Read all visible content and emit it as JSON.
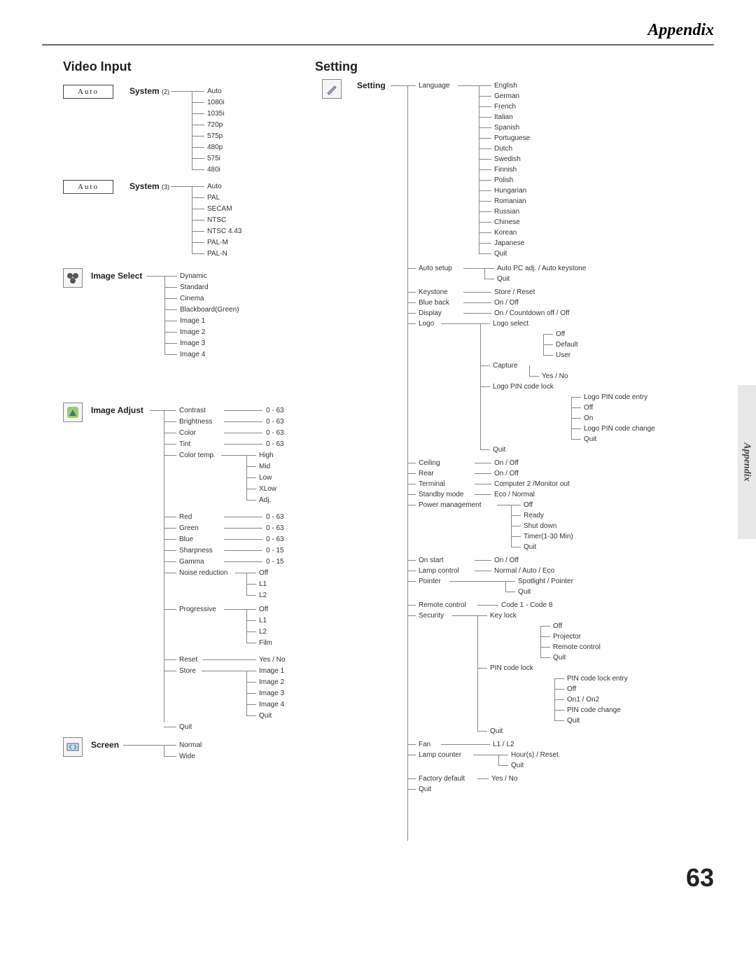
{
  "header": "Appendix",
  "sideTab": "Appendix",
  "pageNumber": "63",
  "left": {
    "title": "Video Input",
    "autoLabel": "Auto",
    "system2": {
      "label": "System",
      "sup": "(2)",
      "items": [
        "Auto",
        "1080i",
        "1035i",
        "720p",
        "575p",
        "480p",
        "575i",
        "480i"
      ]
    },
    "system3": {
      "label": "System",
      "sup": "(3)",
      "items": [
        "Auto",
        "PAL",
        "SECAM",
        "NTSC",
        "NTSC 4.43",
        "PAL-M",
        "PAL-N"
      ]
    },
    "imageSelect": {
      "label": "Image Select",
      "items": [
        "Dynamic",
        "Standard",
        "Cinema",
        "Blackboard(Green)",
        "Image 1",
        "Image 2",
        "Image 3",
        "Image 4"
      ]
    },
    "imageAdjust": {
      "label": "Image Adjust",
      "rows": [
        {
          "name": "Contrast",
          "val": "0 - 63"
        },
        {
          "name": "Brightness",
          "val": "0 - 63"
        },
        {
          "name": "Color",
          "val": "0 - 63"
        },
        {
          "name": "Tint",
          "val": "0 - 63"
        }
      ],
      "colorTemp": {
        "name": "Color temp.",
        "items": [
          "High",
          "Mid",
          "Low",
          "XLow",
          "Adj."
        ]
      },
      "rows2": [
        {
          "name": "Red",
          "val": "0 - 63"
        },
        {
          "name": "Green",
          "val": "0 - 63"
        },
        {
          "name": "Blue",
          "val": "0 - 63"
        },
        {
          "name": "Sharpness",
          "val": "0 - 15"
        },
        {
          "name": "Gamma",
          "val": "0 - 15"
        }
      ],
      "noiseReduction": {
        "name": "Noise reduction",
        "items": [
          "Off",
          "L1",
          "L2"
        ]
      },
      "progressive": {
        "name": "Progressive",
        "items": [
          "Off",
          "L1",
          "L2",
          "Film"
        ]
      },
      "reset": {
        "name": "Reset",
        "val": "Yes / No"
      },
      "store": {
        "name": "Store",
        "items": [
          "Image 1",
          "Image 2",
          "Image 3",
          "Image 4",
          "Quit"
        ]
      },
      "quit": "Quit"
    },
    "screen": {
      "label": "Screen",
      "items": [
        "Normal",
        "Wide"
      ]
    }
  },
  "right": {
    "title": "Setting",
    "settingLabel": "Setting",
    "language": {
      "name": "Language",
      "items": [
        "English",
        "German",
        "French",
        "Italian",
        "Spanish",
        "Portuguese",
        "Dutch",
        "Swedish",
        "Finnish",
        "Polish",
        "Hungarian",
        "Romanian",
        "Russian",
        "Chinese",
        "Korean",
        "Japanese",
        "Quit"
      ]
    },
    "autoSetup": {
      "name": "Auto setup",
      "items": [
        "Auto PC adj. / Auto keystone",
        "Quit"
      ]
    },
    "keystone": {
      "name": "Keystone",
      "val": "Store / Reset"
    },
    "blueBack": {
      "name": "Blue back",
      "val": "On / Off"
    },
    "display": {
      "name": "Display",
      "val": "On / Countdown off / Off"
    },
    "logo": {
      "name": "Logo",
      "logoSelect": {
        "name": "Logo select",
        "items": [
          "Off",
          "Default",
          "User"
        ]
      },
      "capture": {
        "name": "Capture",
        "items": [
          "Yes / No"
        ]
      },
      "pinLock": {
        "name": "Logo PIN code lock",
        "items": [
          "Logo PIN code entry",
          "Off",
          "On",
          "Logo PIN code change",
          "Quit"
        ]
      },
      "quit": "Quit"
    },
    "ceiling": {
      "name": "Ceiling",
      "val": "On / Off"
    },
    "rear": {
      "name": "Rear",
      "val": "On / Off"
    },
    "terminal": {
      "name": "Terminal",
      "val": "Computer 2 /Monitor out"
    },
    "standby": {
      "name": "Standby mode",
      "val": "Eco / Normal"
    },
    "power": {
      "name": "Power management",
      "items": [
        "Off",
        "Ready",
        "Shut down",
        "Timer(1-30 Min)",
        "Quit"
      ]
    },
    "onStart": {
      "name": "On start",
      "val": "On / Off"
    },
    "lampCtrl": {
      "name": "Lamp control",
      "val": "Normal / Auto / Eco"
    },
    "pointer": {
      "name": "Pointer",
      "items": [
        "Spotlight / Pointer",
        "Quit"
      ]
    },
    "remote": {
      "name": "Remote control",
      "val": "Code 1 - Code 8"
    },
    "security": {
      "name": "Security",
      "keyLock": {
        "name": "Key lock",
        "items": [
          "Off",
          "Projector",
          "Remote control",
          "Quit"
        ]
      },
      "pinLock": {
        "name": "PIN code lock",
        "items": [
          "PIN code lock entry",
          "Off",
          "On1 / On2",
          "PIN code change",
          "Quit"
        ]
      },
      "quit": "Quit"
    },
    "fan": {
      "name": "Fan",
      "val": "L1 / L2"
    },
    "lampCnt": {
      "name": "Lamp counter",
      "items": [
        "Hour(s) / Reset",
        "Quit"
      ]
    },
    "factory": {
      "name": "Factory default",
      "val": "Yes / No"
    },
    "quit": "Quit"
  }
}
